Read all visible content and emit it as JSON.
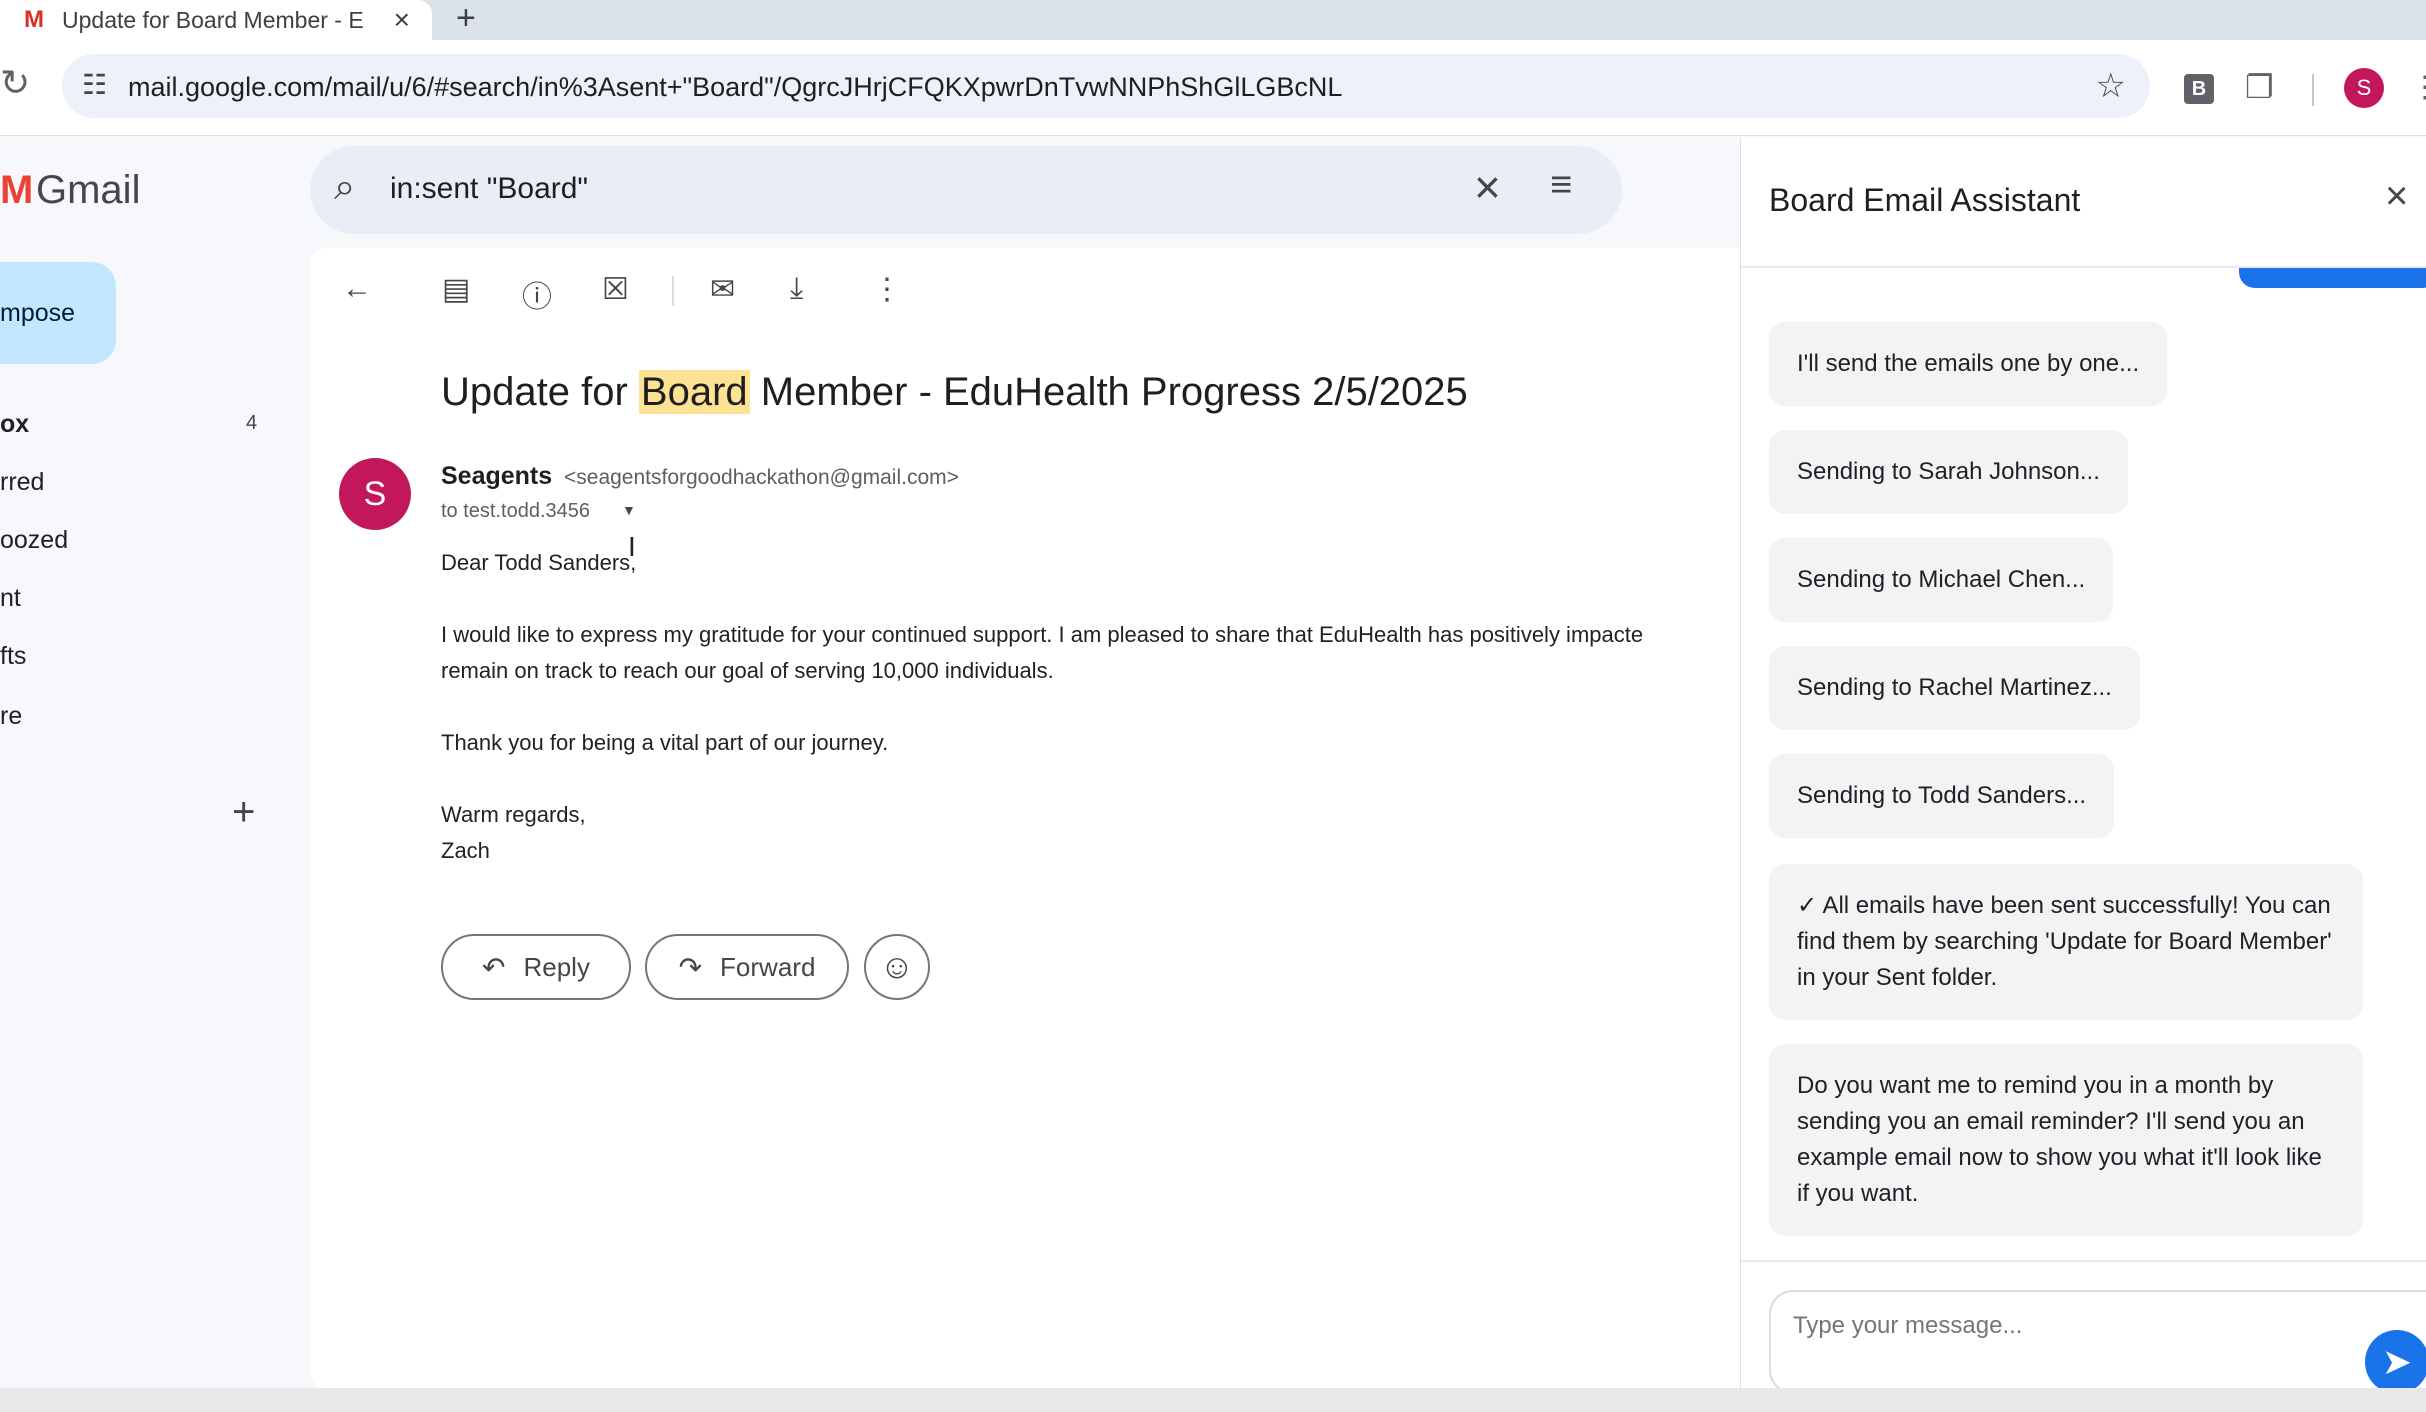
{
  "browser": {
    "tab_icon": "M",
    "tab_title": "Update for Board Member - E",
    "tab_close": "×",
    "new_tab": "+",
    "url": "mail.google.com/mail/u/6/#search/in%3Asent+\"Board\"/QgrcJHrjCFQKXpwrDnTvwNNPhShGlLGBcNL",
    "extension_label": "B",
    "profile_initial": "S"
  },
  "gmail": {
    "logo_text": "Gmail",
    "compose_label": "mpose",
    "nav": [
      {
        "label": "ox",
        "count": "4"
      },
      {
        "label": "rred"
      },
      {
        "label": "oozed"
      },
      {
        "label": "nt"
      },
      {
        "label": "fts"
      },
      {
        "label": "re"
      }
    ],
    "labels_add": "+"
  },
  "search": {
    "query": "in:sent \"Board\""
  },
  "email": {
    "subject_pre": "Update for ",
    "subject_highlight": "Board",
    "subject_post": " Member - EduHealth Progress 2/5/2025",
    "avatar_initial": "S",
    "sender_name": "Seagents",
    "sender_email": "<seagentsforgoodhackathon@gmail.com>",
    "to_line": "to test.todd.3456",
    "body": {
      "greeting": "Dear Todd Sanders,",
      "line1": "I would like to express my gratitude for your continued support. I am pleased to share that EduHealth has positively impacte",
      "line2": "remain on track to reach our goal of serving 10,000 individuals.",
      "line3": "Thank you for being a vital part of our journey.",
      "signoff": "Warm regards,",
      "signature": "Zach"
    },
    "reply_label": "Reply",
    "forward_label": "Forward"
  },
  "assistant": {
    "title": "Board Email Assistant",
    "messages": [
      "I'll send the emails one by one...",
      "Sending to Sarah Johnson...",
      "Sending to Michael Chen...",
      "Sending to Rachel Martinez...",
      "Sending to Todd Sanders...",
      "✓ All emails have been sent successfully! You can find them by searching 'Update for Board Member' in your Sent folder.",
      "Do you want me to remind you in a month by sending you an email reminder? I'll send you an example email now to show you what it'll look like if you want."
    ],
    "input_placeholder": "Type your message..."
  },
  "colors": {
    "accent": "#1a73e8",
    "compose_bg": "#c2e7ff",
    "highlight": "#fde293",
    "avatar": "#c2185b"
  }
}
